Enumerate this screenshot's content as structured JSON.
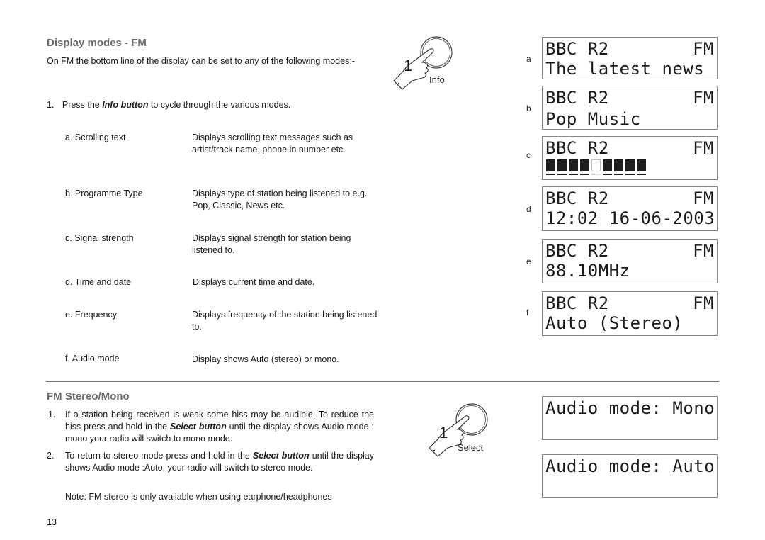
{
  "section1": {
    "title": "Display modes - FM",
    "intro": "On FM the bottom line of the display can be set to any of the following modes:-",
    "step1": {
      "number": "1.",
      "pre": "Press the ",
      "emphasis": "Info button",
      "post": " to cycle through the various modes."
    },
    "modes": [
      {
        "label": "a. Scrolling text",
        "description": "Displays scrolling text messages such as artist/track name, phone in number etc."
      },
      {
        "label": "b. Programme Type",
        "description": "Displays type of station being listened to e.g. Pop, Classic, News etc."
      },
      {
        "label": "c. Signal strength",
        "description": "Displays signal strength for station being listened to."
      },
      {
        "label": "d. Time and date",
        "description": "Displays current time and date."
      },
      {
        "label": "e. Frequency",
        "description": "Displays frequency of the station being listened to."
      },
      {
        "label": "f. Audio mode",
        "description": "Display shows Auto (stereo) or mono."
      }
    ],
    "button_illustration": {
      "step_number": "1",
      "label": "Info",
      "icon": "pointing-hand-icon"
    },
    "displays": [
      {
        "letter": "a",
        "station": "BBC R2",
        "band": "FM",
        "line2": "The latest news"
      },
      {
        "letter": "b",
        "station": "BBC R2",
        "band": "FM",
        "line2": "Pop Music"
      },
      {
        "letter": "c",
        "station": "BBC R2",
        "band": "FM",
        "signal_segments": [
          1,
          1,
          1,
          1,
          0,
          1,
          1,
          1,
          1
        ]
      },
      {
        "letter": "d",
        "station": "BBC R2",
        "band": "FM",
        "line2": "12:02 16-06-2003"
      },
      {
        "letter": "e",
        "station": "BBC R2",
        "band": "FM",
        "line2": "88.10MHz"
      },
      {
        "letter": "f",
        "station": "BBC R2",
        "band": "FM",
        "line2": "Auto (Stereo)"
      }
    ]
  },
  "section2": {
    "title": "FM Stereo/Mono",
    "steps": [
      {
        "number": "1.",
        "pre": "If a station being received is weak some hiss may be audible. To reduce the hiss press and hold in the ",
        "emphasis": "Select button",
        "post": " until the display shows Audio mode : mono your radio will  switch to mono mode."
      },
      {
        "number": "2.",
        "pre": "To return to stereo mode press and  hold in the ",
        "emphasis": "Select button",
        "post": " until the display shows Audio mode :Auto, your radio will  switch  to stereo mode."
      }
    ],
    "note": "Note: FM stereo is only available when using earphone/headphones",
    "button_illustration": {
      "step_number": "1",
      "label": "Select",
      "icon": "pointing-hand-icon"
    },
    "displays": [
      {
        "line1": "Audio mode: Mono"
      },
      {
        "line1": "Audio mode: Auto"
      }
    ]
  },
  "page_number": "13"
}
